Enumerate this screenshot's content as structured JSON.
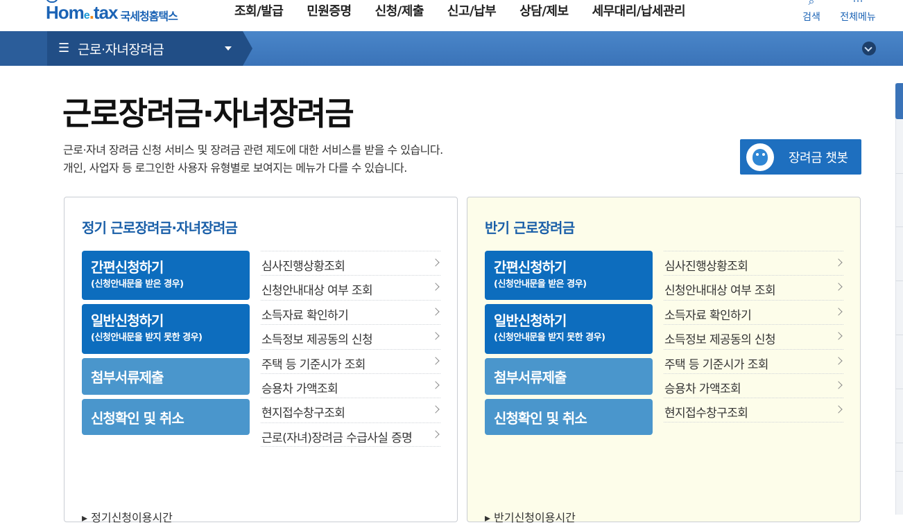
{
  "header": {
    "logo_tagline": "안녕하세요 국세청입니다",
    "logo_text_pre": "Hom",
    "logo_text_e": "e",
    "logo_text_post": "tax",
    "logo_kr": "국세청홈택스",
    "nav": [
      "조회/발급",
      "민원증명",
      "신청/제출",
      "신고/납부",
      "상담/제보",
      "세무대리/납세관리"
    ],
    "search_label": "검색",
    "menu_label": "전체메뉴"
  },
  "breadcrumb": {
    "label": "근로·자녀장려금"
  },
  "page": {
    "title": "근로장려금·자녀장려금",
    "desc_line1": "근로·자녀 장려금 신청 서비스 및 장려금 관련 제도에 대한 서비스를 받을 수 있습니다.",
    "desc_line2": "개인, 사업자 등 로그인한 사용자 유형별로 보여지는 메뉴가 다를 수 있습니다.",
    "chatbot_label": "장려금 챗봇"
  },
  "panels": [
    {
      "title": "정기 근로장려금·자녀장려금",
      "buttons": [
        {
          "title": "간편신청하기",
          "sub": "(신청안내문을 받은 경우)"
        },
        {
          "title": "일반신청하기",
          "sub": "(신청안내문을 받지 못한 경우)"
        },
        {
          "title": "첨부서류제출"
        },
        {
          "title": "신청확인 및 취소"
        }
      ],
      "links": [
        "심사진행상황조회",
        "신청안내대상 여부 조회",
        "소득자료 확인하기",
        "소득정보 제공동의 신청",
        "주택 등 기준시가 조회",
        "승용차 가액조회",
        "현지접수창구조회",
        "근로(자녀)장려금 수급사실 증명"
      ],
      "bottom": "정기신청이용시간"
    },
    {
      "title": "반기 근로장려금",
      "buttons": [
        {
          "title": "간편신청하기",
          "sub": "(신청안내문을 받은 경우)"
        },
        {
          "title": "일반신청하기",
          "sub": "(신청안내문을 받지 못한 경우)"
        },
        {
          "title": "첨부서류제출"
        },
        {
          "title": "신청확인 및 취소"
        }
      ],
      "links": [
        "심사진행상황조회",
        "신청안내대상 여부 조회",
        "소득자료 확인하기",
        "소득정보 제공동의 신청",
        "주택 등 기준시가 조회",
        "승용차 가액조회",
        "현지접수창구조회"
      ],
      "bottom": "반기신청이용시간"
    }
  ],
  "colors": {
    "brand_blue": "#1b63b5",
    "button_dark": "#0d6dbe",
    "button_light": "#4a96cc",
    "panel_right_bg": "#fdfdea"
  }
}
